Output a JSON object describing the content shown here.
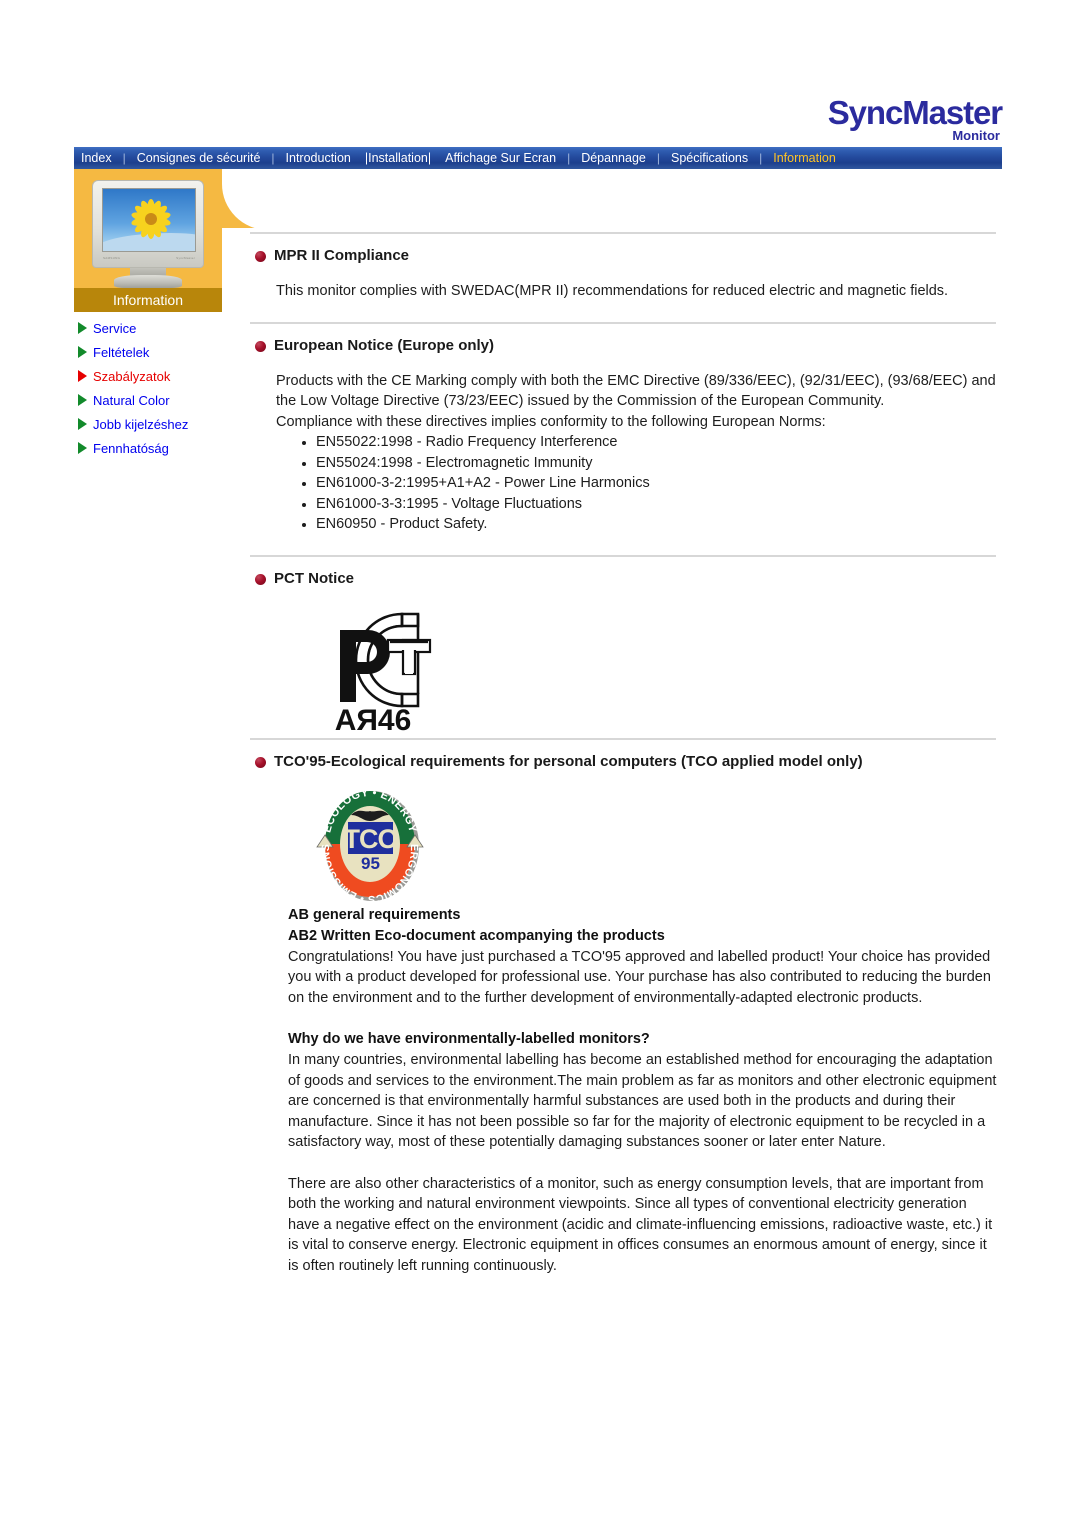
{
  "brand": {
    "name": "SyncMaster",
    "sub": "Monitor"
  },
  "navbar": {
    "items": [
      {
        "label": "Index",
        "active": false
      },
      {
        "label": "Consignes de sécurité",
        "active": false
      },
      {
        "label": "Introduction",
        "active": false
      },
      {
        "label": "|Installation|",
        "active": false
      },
      {
        "label": "Affichage Sur Ecran",
        "active": false
      },
      {
        "label": "Dépannage",
        "active": false
      },
      {
        "label": "Spécifications",
        "active": false
      },
      {
        "label": "Information",
        "active": true
      }
    ],
    "separator": "|",
    "bg_color": "#23499c",
    "active_color": "#ffc425"
  },
  "sidebar": {
    "panel_color": "#f5b942",
    "band_color": "#b8860b",
    "band_label": "Information",
    "monitor_icon": "monitor-with-flower-image",
    "items": [
      {
        "label": "Service",
        "selected": false
      },
      {
        "label": "Feltételek",
        "selected": false
      },
      {
        "label": "Szabályzatok",
        "selected": true
      },
      {
        "label": "Natural Color",
        "selected": false
      },
      {
        "label": "Jobb kijelzéshez",
        "selected": false
      },
      {
        "label": "Fennhatóság",
        "selected": false
      }
    ],
    "link_color": "#0000ee",
    "selected_color": "#e60000",
    "arrow_color": "#128a2b"
  },
  "content": {
    "sections": {
      "mpr": {
        "heading": "MPR II Compliance",
        "body": "This monitor complies with SWEDAC(MPR II) recommendations for reduced electric and magnetic fields."
      },
      "european": {
        "heading": "European Notice (Europe only)",
        "para1": "Products with the CE Marking comply with both the EMC Directive (89/336/EEC), (92/31/EEC), (93/68/EEC) and the Low Voltage Directive (73/23/EEC) issued by the Commission of the European Community.",
        "para2": "Compliance with these directives implies conformity to the following European Norms:",
        "norms": [
          "EN55022:1998 - Radio Frequency Interference",
          "EN55024:1998 - Electromagnetic Immunity",
          "EN61000-3-2:1995+A1+A2 - Power Line Harmonics",
          "EN61000-3-3:1995 - Voltage Fluctuations",
          "EN60950 - Product Safety."
        ]
      },
      "pct": {
        "heading": "PCT Notice",
        "logo_text": "AЯ46",
        "logo_name": "pct-certification-logo"
      },
      "tco": {
        "heading": "TCO'95-Ecological requirements for personal computers (TCO applied model only)",
        "logo_name": "tco-95-logo",
        "logo_top_text": "ECOLOGY • ENERGY",
        "logo_bottom_text": "ERGONOMICS • EMISSIONS",
        "logo_center": "TCO",
        "logo_year": "95",
        "sub1": "AB general requirements",
        "sub2": "AB2 Written Eco-document acompanying the products",
        "para1": "Congratulations! You have just purchased a TCO'95 approved and labelled product! Your choice has provided you with a product developed for professional use. Your purchase has also contributed to reducing the burden on the environment and to the further development of environmentally-adapted electronic products.",
        "sub3": "Why do we have environmentally-labelled monitors?",
        "para2": "In many countries, environmental labelling has become an established method for encouraging the adaptation of goods and services to the environment.The main problem as far as monitors and other electronic equipment are concerned is that environmentally harmful substances are used both in the products and during their manufacture. Since it has not been possible so far for the majority of electronic equipment to be recycled in a satisfactory way, most of these potentially damaging substances sooner or later enter Nature.",
        "para3": "There are also other characteristics of a monitor, such as energy consumption levels, that are important from both the working and natural environment viewpoints. Since all types of conventional electricity generation have a negative effect on the environment (acidic and climate-influencing emissions, radioactive waste, etc.) it is vital to conserve energy. Electronic equipment in offices consumes an enormous amount of energy, since it is often routinely left running continuously."
      }
    }
  }
}
